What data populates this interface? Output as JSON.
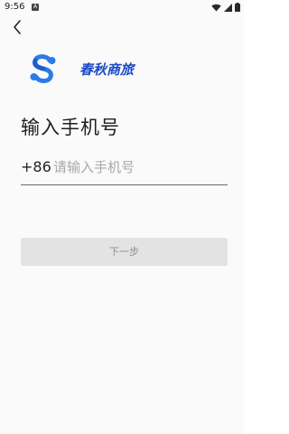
{
  "status_bar": {
    "time": "9:56",
    "notification_icon": "A",
    "icons": [
      "wifi-icon",
      "signal-icon",
      "battery-icon"
    ]
  },
  "header": {
    "back_icon": "chevron-left-icon"
  },
  "brand": {
    "logo_icon": "s-logo-icon",
    "name": "春秋商旅",
    "color": "#1a49c9"
  },
  "title": "输入手机号",
  "phone": {
    "country_code": "+86",
    "placeholder": "请输入手机号",
    "value": ""
  },
  "next_button": {
    "label": "下一步",
    "enabled": false
  }
}
